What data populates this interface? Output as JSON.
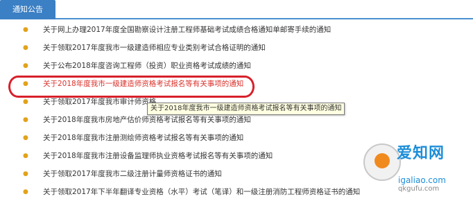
{
  "tab": {
    "label": "通知公告"
  },
  "items": [
    {
      "text": "关于网上办理2017年度全国勘察设计注册工程师基础考试成绩合格通知单邮寄手续的通知"
    },
    {
      "text": "关于领取2017年度我市一级建造师相应专业类别考试合格证明的通知"
    },
    {
      "text": "关于公布2018年度咨询工程师（投资）职业资格考试成绩的通知"
    },
    {
      "text": "关于2018年度我市一级建造师资格考试报名等有关事项的通知"
    },
    {
      "text": "关于领取2017年度我市审计师资格"
    },
    {
      "text": "关于2018年度我市房地产估价师资格考试报名等有关事项的通知"
    },
    {
      "text": "关于2018年度我市注册测绘师资格考试报名等有关事项的通知"
    },
    {
      "text": "关于2018年度我市注册设备监理师执业资格考试报名等有关事项的通知"
    },
    {
      "text": "关于领取2017年度我市二级注册计量师资格证书的通知"
    },
    {
      "text": "关于领取2017年下半年翻译专业资格（水平）考试（笔译）和一级注册消防工程师资格证书的通知"
    }
  ],
  "highlighted_index": 3,
  "tooltip": {
    "text": "关于2018年度我市一级建造师资格考试报名等有关事项的通知"
  },
  "watermark": {
    "brand": "爱知网",
    "url": "igaliao.com",
    "url2": "qkgufu.com"
  },
  "colors": {
    "tab_bg": "#3b7fc4",
    "bullet": "#e2a21a",
    "highlight_text": "#d9322b",
    "ring": "#d8202a"
  }
}
